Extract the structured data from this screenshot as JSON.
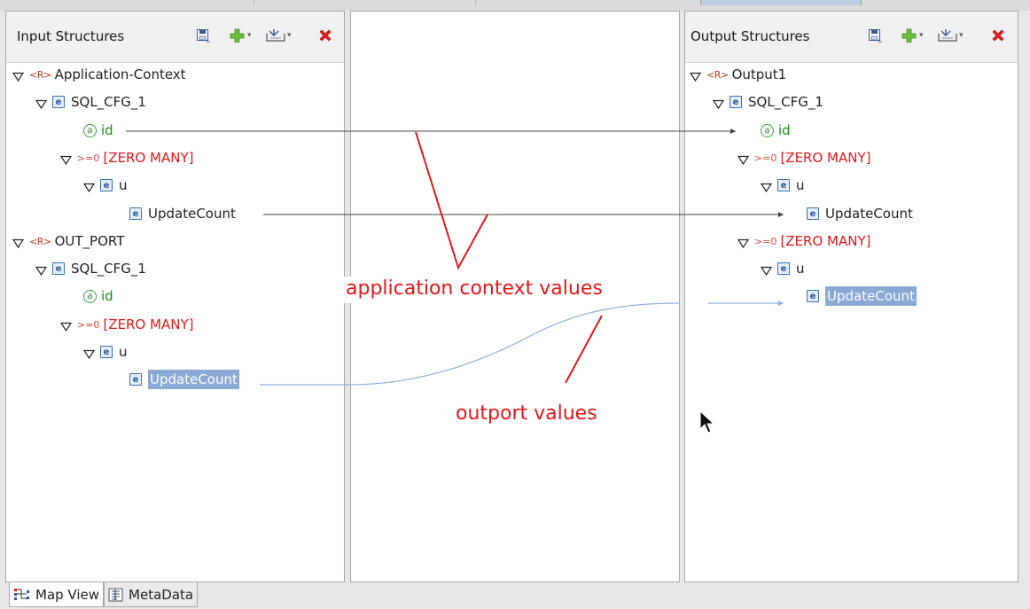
{
  "input_panel": {
    "title": "Input Structures",
    "tree": [
      {
        "kind": "root",
        "label": "Application-Context",
        "marker": "<R>"
      },
      {
        "kind": "element",
        "label": "SQL_CFG_1",
        "marker": "e"
      },
      {
        "kind": "attribute",
        "label": "id",
        "marker": "a"
      },
      {
        "kind": "multiplicity",
        "label": "[ZERO MANY]",
        "marker": ">=0"
      },
      {
        "kind": "element",
        "label": "u",
        "marker": "e"
      },
      {
        "kind": "element",
        "label": "UpdateCount",
        "marker": "e"
      },
      {
        "kind": "root",
        "label": "OUT_PORT",
        "marker": "<R>"
      },
      {
        "kind": "element",
        "label": "SQL_CFG_1",
        "marker": "e"
      },
      {
        "kind": "attribute",
        "label": "id",
        "marker": "a"
      },
      {
        "kind": "multiplicity",
        "label": "[ZERO MANY]",
        "marker": ">=0"
      },
      {
        "kind": "element",
        "label": "u",
        "marker": "e"
      },
      {
        "kind": "element",
        "label": "UpdateCount",
        "marker": "e",
        "selected": true
      }
    ]
  },
  "output_panel": {
    "title": "Output Structures",
    "tree": [
      {
        "kind": "root",
        "label": "Output1",
        "marker": "<R>"
      },
      {
        "kind": "element",
        "label": "SQL_CFG_1",
        "marker": "e"
      },
      {
        "kind": "attribute",
        "label": "id",
        "marker": "a"
      },
      {
        "kind": "multiplicity",
        "label": "[ZERO MANY]",
        "marker": ">=0"
      },
      {
        "kind": "element",
        "label": "u",
        "marker": "e"
      },
      {
        "kind": "element",
        "label": "UpdateCount",
        "marker": "e"
      },
      {
        "kind": "multiplicity",
        "label": "[ZERO MANY]",
        "marker": ">=0"
      },
      {
        "kind": "element",
        "label": "u",
        "marker": "e"
      },
      {
        "kind": "element",
        "label": "UpdateCount",
        "marker": "e",
        "selected": true
      }
    ]
  },
  "toolbar_icons": [
    "save-icon",
    "add-icon",
    "import-icon",
    "delete-icon"
  ],
  "annotations": {
    "application_context": "application context values",
    "outport": "outport values"
  },
  "bottom_tabs": [
    {
      "label": "Map View",
      "icon": "map-view-icon",
      "active": true
    },
    {
      "label": "MetaData",
      "icon": "metadata-icon",
      "active": false
    }
  ],
  "colors": {
    "selection": "#8aa9d4",
    "attribute_green": "#1f8a1f",
    "multiplicity_red": "#e01818",
    "annotation_red": "#e01818",
    "mapping_line": "#444444",
    "mapping_line_selected": "#8fb0d8"
  }
}
